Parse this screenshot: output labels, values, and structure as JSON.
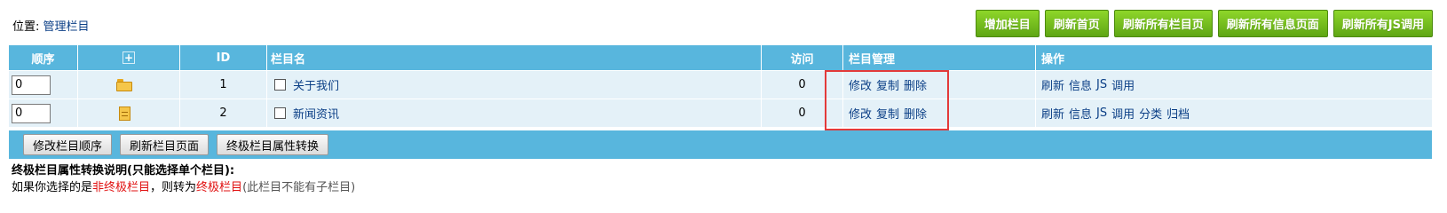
{
  "location": {
    "label": "位置:",
    "link": "管理栏目"
  },
  "top_buttons": [
    "增加栏目",
    "刷新首页",
    "刷新所有栏目页",
    "刷新所有信息页面",
    "刷新所有JS调用"
  ],
  "table": {
    "headers": {
      "order": "顺序",
      "expand": "+",
      "id": "ID",
      "name": "栏目名",
      "visits": "访问",
      "manage": "栏目管理",
      "ops": "操作"
    },
    "rows": [
      {
        "order": "0",
        "icon": "folder-icon",
        "id": "1",
        "name": "关于我们",
        "visits": "0",
        "manage": [
          "修改",
          "复制",
          "删除"
        ],
        "ops": [
          "刷新",
          "信息",
          "JS",
          "调用"
        ]
      },
      {
        "order": "0",
        "icon": "document-icon",
        "id": "2",
        "name": "新闻资讯",
        "visits": "0",
        "manage": [
          "修改",
          "复制",
          "删除"
        ],
        "ops": [
          "刷新",
          "信息",
          "JS",
          "调用",
          "分类",
          "归档"
        ]
      }
    ]
  },
  "action_buttons": [
    "修改栏目顺序",
    "刷新栏目页面",
    "终极栏目属性转换"
  ],
  "note": {
    "title": "终极栏目属性转换说明(只能选择单个栏目):",
    "line_prefix": "如果你选择的是",
    "red1": "非终极栏目",
    "middle": "，则转为",
    "red2": "终极栏目",
    "suffix": "(此栏目不能有子栏目)"
  },
  "colors": {
    "header_bg": "#58b6dd",
    "row_bg": "#e4f1f8",
    "green_button": "#6fb81f",
    "highlight_box": "#e33a3a",
    "link": "#0b3f86"
  }
}
